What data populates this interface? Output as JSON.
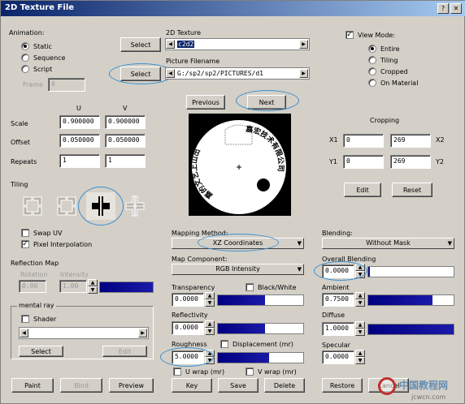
{
  "window": {
    "title": "2D Texture File"
  },
  "animation": {
    "label": "Animation:",
    "options": [
      "Static",
      "Sequence",
      "Script"
    ],
    "selected": "Static",
    "frame_label": "Frame",
    "frame_value": "0"
  },
  "texture": {
    "label": "2D Texture",
    "select_label": "Select",
    "value": "c2d2",
    "filename_label": "Picture Filename",
    "select2_label": "Select",
    "filename": "G:/sp2/sp2/PICTURES/d1",
    "prev_label": "Previous",
    "next_label": "Next"
  },
  "view_mode": {
    "label": "View Mode:",
    "options": [
      "Entire",
      "Tiling",
      "Cropped",
      "On Material"
    ],
    "selected": "Entire"
  },
  "uv": {
    "u_header": "U",
    "v_header": "V",
    "scale_label": "Scale",
    "scale_u": "0.900000",
    "scale_v": "0.900000",
    "offset_label": "Offset",
    "offset_u": "0.050000",
    "offset_v": "0.050000",
    "repeats_label": "Repeats",
    "repeats_u": "1",
    "repeats_v": "1"
  },
  "cropping": {
    "label": "Cropping",
    "x1_label": "X1",
    "x1": "0",
    "x2_label": "X2",
    "x2": "269",
    "y1_label": "Y1",
    "y1": "0",
    "y2_label": "Y2",
    "y2": "269",
    "edit_label": "Edit",
    "reset_label": "Reset"
  },
  "tiling": {
    "label": "Tiling",
    "swap_uv": "Swap UV",
    "pixel_interp": "Pixel Interpolation"
  },
  "reflection": {
    "label": "Reflection Map",
    "rotation_label": "Rotation",
    "intensity_label": "Intensity",
    "rotation": "0.00",
    "intensity": "1.00"
  },
  "mental_ray": {
    "label": "mental ray",
    "shader_label": "Shader",
    "select_label": "Select",
    "edit_label": "Edit"
  },
  "mapping": {
    "method_label": "Mapping Method:",
    "method": "XZ Coordinates",
    "component_label": "Map Component:",
    "component": "RGB Intensity"
  },
  "blending": {
    "label": "Blending:",
    "value": "Without Mask",
    "overall_label": "Overall Blending",
    "overall": "0.0000"
  },
  "material": {
    "transparency_label": "Transparency",
    "transparency": "0.0000",
    "black_white_label": "Black/White",
    "reflectivity_label": "Reflectivity",
    "reflectivity": "0.0000",
    "roughness_label": "Roughness",
    "displacement_label": "Displacement (mr)",
    "roughness": "5.0000",
    "u_wrap_label": "U wrap (mr)",
    "v_wrap_label": "V wrap (mr)",
    "ambient_label": "Ambient",
    "ambient": "0.7500",
    "ambient_level": 0.75,
    "diffuse_label": "Diffuse",
    "diffuse": "1.0000",
    "diffuse_level": 1.0,
    "specular_label": "Specular",
    "specular": "0.0000",
    "transparency_level": 0.55,
    "reflectivity_level": 0.55,
    "roughness_level": 0.6
  },
  "footer": {
    "paint": "Paint",
    "bind": "Bind",
    "preview": "Preview",
    "key": "Key",
    "save": "Save",
    "delete": "Delete",
    "restore": "Restore",
    "cancel": "Cancel"
  },
  "preview_text": {
    "left_arc": "嘉的文艺上山出",
    "right_arc": "嘉宏技术有限公司"
  },
  "watermark": {
    "cn": "中国教程网",
    "url": "jcwcn.com"
  },
  "colors": {
    "title_start": "#0a246a",
    "title_end": "#a6caf0",
    "bar_fill": "#000080",
    "highlight": "#3a8fd0"
  }
}
